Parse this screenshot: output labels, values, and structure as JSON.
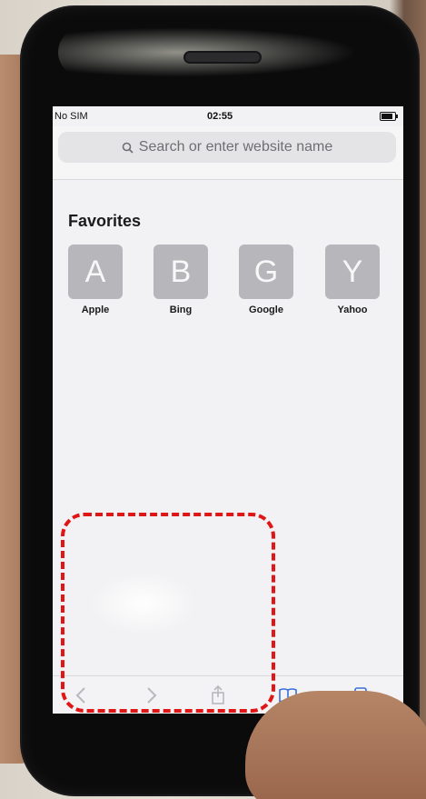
{
  "status_bar": {
    "carrier": "No SIM",
    "time": "02:55",
    "battery_icon": "battery-icon"
  },
  "search": {
    "placeholder": "Search or enter website name",
    "icon": "search-icon"
  },
  "favorites": {
    "title": "Favorites",
    "items": [
      {
        "letter": "A",
        "label": "Apple"
      },
      {
        "letter": "B",
        "label": "Bing"
      },
      {
        "letter": "G",
        "label": "Google"
      },
      {
        "letter": "Y",
        "label": "Yahoo"
      }
    ]
  },
  "toolbar": {
    "icons": [
      "back-icon",
      "forward-icon",
      "share-icon",
      "bookmarks-icon",
      "tabs-icon"
    ]
  },
  "annotation": {
    "color": "#e01616"
  }
}
